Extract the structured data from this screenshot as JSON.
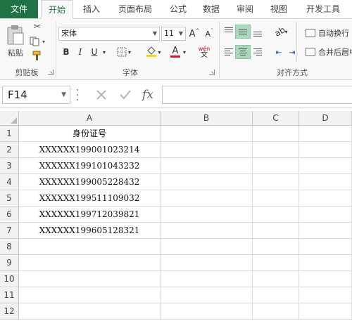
{
  "tabs": {
    "file": "文件",
    "home": "开始",
    "insert": "插入",
    "page_layout": "页面布局",
    "formulas": "公式",
    "data": "数据",
    "review": "审阅",
    "view": "视图",
    "developer": "开发工具"
  },
  "ribbon": {
    "clipboard": {
      "paste_label": "粘贴",
      "group_label": "剪贴板"
    },
    "font": {
      "font_name": "宋体",
      "font_size": "11",
      "grow_label": "A",
      "shrink_label": "A",
      "bold_label": "B",
      "italic_label": "I",
      "underline_label": "U",
      "font_color_label": "A",
      "phonetic_top": "wén",
      "phonetic_bottom": "文",
      "group_label": "字体",
      "accent_yellow": "#ffd800",
      "accent_red": "#e81123"
    },
    "alignment": {
      "wrap_text_label": "自动换行",
      "merge_center_label": "合并后居中",
      "group_label": "对齐方式"
    }
  },
  "formula_bar": {
    "name_box": "F14",
    "fx_label": "fx",
    "formula_value": ""
  },
  "grid": {
    "columns": [
      "A",
      "B",
      "C",
      "D"
    ],
    "row_numbers": [
      "1",
      "2",
      "3",
      "4",
      "5",
      "6",
      "7",
      "8",
      "9",
      "10",
      "11",
      "12"
    ],
    "column_a_values": [
      "身份证号",
      "XXXXXX199001023214",
      "XXXXXX199101043232",
      "XXXXXX199005228432",
      "XXXXXX199511109032",
      "XXXXXX199712039821",
      "XXXXXX199605128321",
      "",
      "",
      "",
      "",
      ""
    ]
  },
  "colors": {
    "excel_green": "#217346",
    "active_align": "#a9d9bb"
  }
}
